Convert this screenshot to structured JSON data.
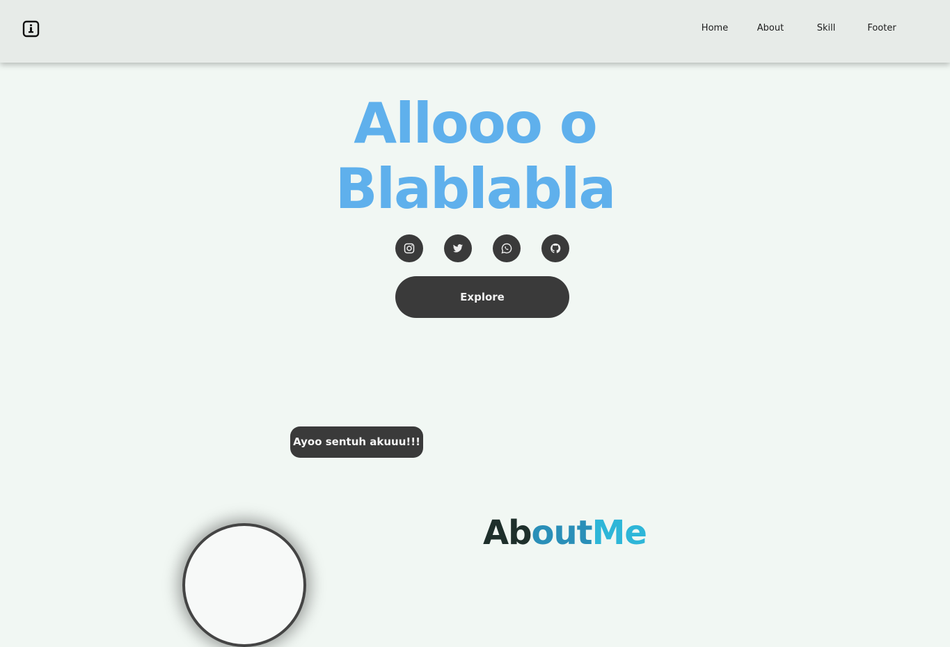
{
  "navbar": {
    "logo_icon": "info-square-icon",
    "links": [
      "Home",
      "About",
      "Skill",
      "Footer"
    ]
  },
  "hero": {
    "line1": "Allooo o",
    "line2": "Blablabla",
    "title_color": "#5fb0ec",
    "socials": [
      "instagram-icon",
      "twitter-icon",
      "whatsapp-icon",
      "github-icon"
    ],
    "explore_label": "Explore",
    "tooltip_text": "Ayoo sentuh akuuu!!!"
  },
  "about": {
    "title_part1": "Ab",
    "title_part2": "out",
    "title_part3": "Me"
  },
  "colors": {
    "background": "#f1f7f3",
    "navbar": "#e7ebe8",
    "dark": "#3a3a3a"
  }
}
